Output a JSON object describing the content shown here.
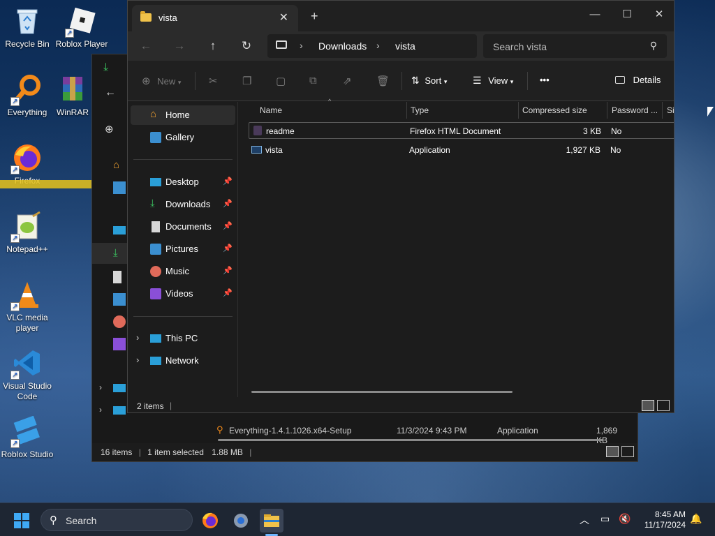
{
  "desktop": {
    "icons": [
      {
        "label": "Recycle Bin"
      },
      {
        "label": "Roblox Player"
      },
      {
        "label": "Everything"
      },
      {
        "label": "WinRAR"
      },
      {
        "label": "Firefox"
      },
      {
        "label": "Notepad++"
      },
      {
        "label": "VLC media player"
      },
      {
        "label": "Visual Studio Code"
      },
      {
        "label": "Roblox Studio"
      }
    ]
  },
  "bg_window": {
    "row": {
      "name": "Everything-1.4.1.1026.x64-Setup",
      "date": "11/3/2024 9:43 PM",
      "type": "Application",
      "size": "1,869 KB"
    },
    "status": {
      "count": "16 items",
      "selected": "1 item selected",
      "size": "1.88 MB"
    }
  },
  "window": {
    "tab_title": "vista",
    "breadcrumb": [
      "Downloads",
      "vista"
    ],
    "search_placeholder": "Search vista",
    "toolbar": {
      "new": "New",
      "sort": "Sort",
      "view": "View",
      "more": "•••",
      "details": "Details"
    },
    "sidebar": {
      "top": [
        "Home",
        "Gallery"
      ],
      "pinned": [
        "Desktop",
        "Downloads",
        "Documents",
        "Pictures",
        "Music",
        "Videos"
      ],
      "bottom": [
        "This PC",
        "Network"
      ]
    },
    "columns": [
      "Name",
      "Type",
      "Compressed size",
      "Password ...",
      "Si"
    ],
    "rows": [
      {
        "name": "readme",
        "type": "Firefox HTML Document",
        "size": "3 KB",
        "password": "No"
      },
      {
        "name": "vista",
        "type": "Application",
        "size": "1,927 KB",
        "password": "No"
      }
    ],
    "status": {
      "count": "2 items"
    }
  },
  "taskbar": {
    "search_placeholder": "Search",
    "time": "8:45 AM",
    "date": "11/17/2024"
  }
}
